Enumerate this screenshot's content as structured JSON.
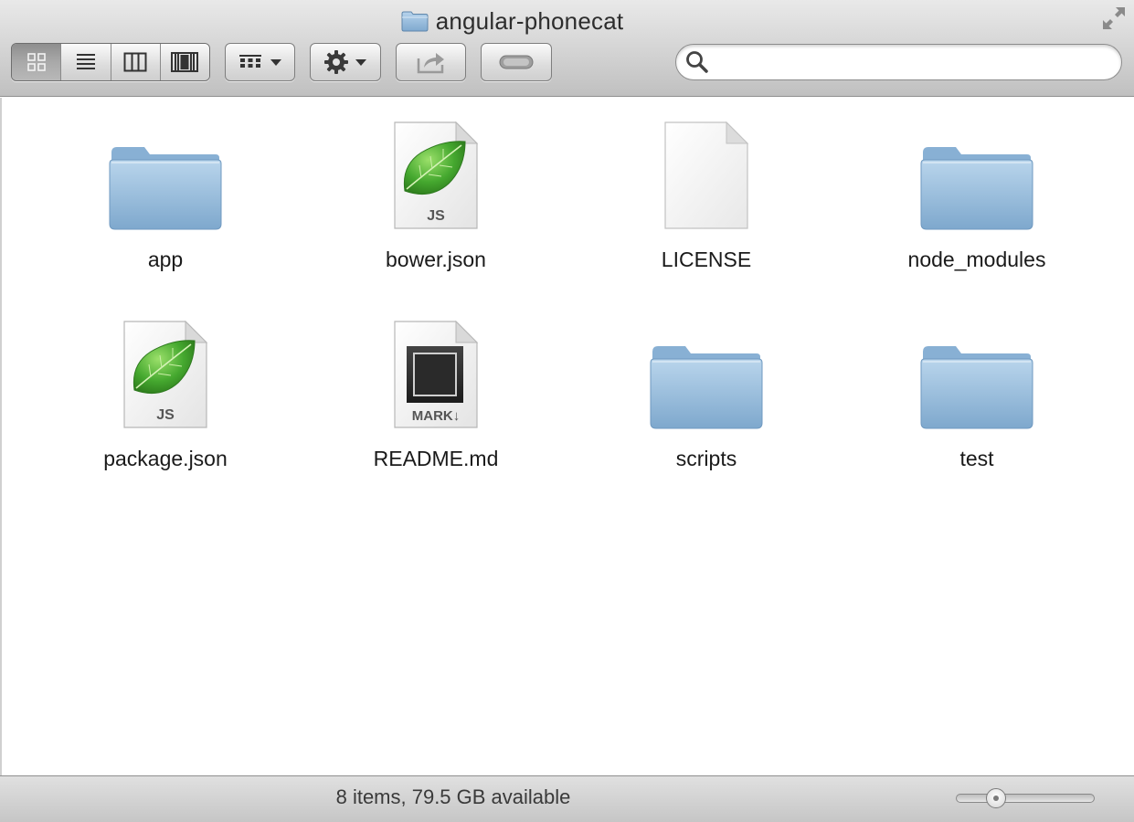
{
  "window": {
    "title": "angular-phonecat"
  },
  "toolbar": {
    "view_modes": [
      {
        "name": "icon-view",
        "active": true
      },
      {
        "name": "list-view",
        "active": false
      },
      {
        "name": "column-view",
        "active": false
      },
      {
        "name": "coverflow-view",
        "active": false
      }
    ],
    "search": {
      "placeholder": "",
      "value": ""
    }
  },
  "files": [
    {
      "name": "app",
      "kind": "folder-icon"
    },
    {
      "name": "bower.json",
      "kind": "js-file-icon",
      "badge": "JS"
    },
    {
      "name": "LICENSE",
      "kind": "blank-document-icon"
    },
    {
      "name": "node_modules",
      "kind": "folder-icon"
    },
    {
      "name": "package.json",
      "kind": "js-file-icon",
      "badge": "JS"
    },
    {
      "name": "README.md",
      "kind": "markdown-file-icon",
      "badge": "MARK↓"
    },
    {
      "name": "scripts",
      "kind": "folder-icon"
    },
    {
      "name": "test",
      "kind": "folder-icon"
    }
  ],
  "status": {
    "text": "8 items, 79.5 GB available"
  },
  "icon_size_slider": {
    "level": 0.25
  },
  "colors": {
    "folder": "#8cb8dd",
    "leaf": "#4aa83c",
    "toolbar": "#d3d3d3"
  }
}
